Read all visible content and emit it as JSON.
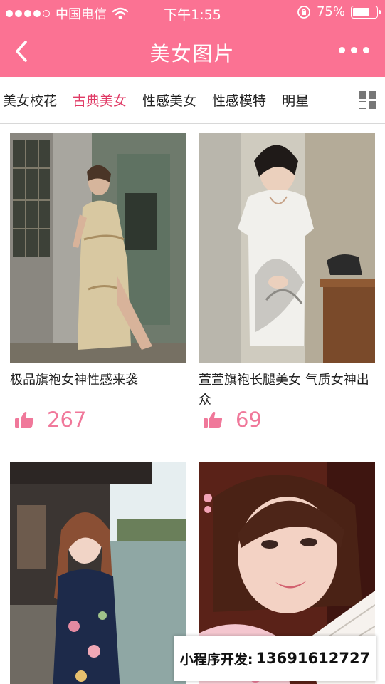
{
  "status_bar": {
    "carrier": "中国电信",
    "time": "下午1:55",
    "battery": "75%",
    "battery_level": 0.75
  },
  "nav": {
    "title": "美女图片",
    "back_icon": "chevron-left-icon",
    "more_icon": "more-dots-icon"
  },
  "tabs": {
    "items": [
      "美女校花",
      "古典美女",
      "性感美女",
      "性感模特",
      "明星"
    ],
    "active": "古典美女",
    "grid_icon": "grid-icon"
  },
  "cards": [
    {
      "title": "极品旗袍女神性感来袭",
      "likes": "267"
    },
    {
      "title": "萱萱旗袍长腿美女 气质女神出众",
      "likes": "69"
    },
    {
      "title": "",
      "likes": ""
    },
    {
      "title": "",
      "likes": ""
    }
  ],
  "watermark": {
    "label": "小程序开发:",
    "phone": "13691612727"
  },
  "colors": {
    "accent": "#fb7293",
    "active_tab": "#e03b66",
    "like_count": "#f0789a"
  }
}
